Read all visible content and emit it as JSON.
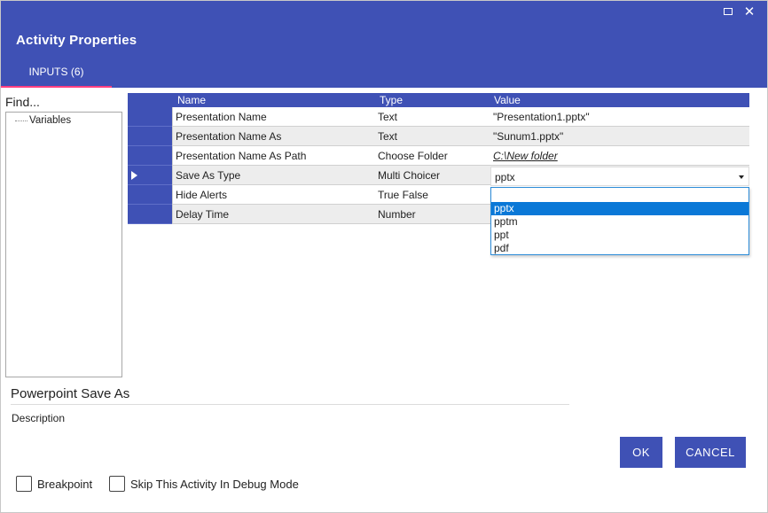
{
  "window": {
    "title": "Activity Properties",
    "maximize_icon": "maximize-icon",
    "close_icon": "close-icon",
    "close_glyph": "✕"
  },
  "tabs": [
    {
      "label": "INPUTS (6)",
      "active": true
    }
  ],
  "left_panel": {
    "find_placeholder": "Find...",
    "tree_items": [
      "Variables"
    ]
  },
  "grid": {
    "columns": [
      "Name",
      "Type",
      "Value"
    ],
    "rows": [
      {
        "name": "Presentation Name",
        "type": "Text",
        "value": "\"Presentation1.pptx\"",
        "pointer": false
      },
      {
        "name": "Presentation Name As",
        "type": "Text",
        "value": "\"Sunum1.pptx\"",
        "pointer": false
      },
      {
        "name": "Presentation Name As Path",
        "type": "Choose Folder",
        "value": "C:\\New folder",
        "pointer": false
      },
      {
        "name": "Save As Type",
        "type": "Multi Choicer",
        "value": "pptx",
        "pointer": true
      },
      {
        "name": "Hide Alerts",
        "type": "True False",
        "value": "",
        "pointer": false
      },
      {
        "name": "Delay Time",
        "type": "Number",
        "value": "",
        "pointer": false
      }
    ]
  },
  "dropdown": {
    "selected": "pptx",
    "options": [
      "pptx",
      "pptm",
      "ppt",
      "pdf"
    ]
  },
  "activity": {
    "name": "Powerpoint Save As",
    "description": "Description"
  },
  "buttons": {
    "ok": "OK",
    "cancel": "CANCEL"
  },
  "checkboxes": {
    "breakpoint": "Breakpoint",
    "skip_debug": "Skip This Activity In Debug Mode"
  },
  "colors": {
    "primary": "#3f51b5",
    "tab_indicator": "#ff4081",
    "selection": "#0a78d7"
  }
}
